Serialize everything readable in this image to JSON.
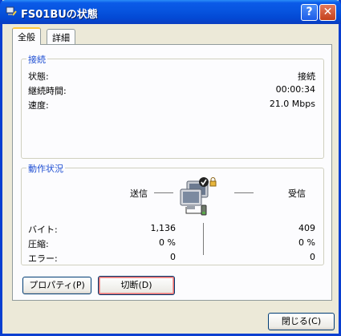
{
  "window": {
    "title": "FS01BUの状態",
    "help_glyph": "?",
    "close_glyph": "✕"
  },
  "tabs": [
    {
      "label": "全般",
      "active": true
    },
    {
      "label": "詳細",
      "active": false
    }
  ],
  "connection": {
    "legend": "接続",
    "rows": [
      {
        "label": "状態:",
        "value": "接続"
      },
      {
        "label": "継続時間:",
        "value": "00:00:34"
      },
      {
        "label": "速度:",
        "value": "21.0 Mbps"
      }
    ]
  },
  "activity": {
    "legend": "動作状況",
    "sent_label": "送信",
    "received_label": "受信",
    "rows": [
      {
        "label": "バイト:",
        "sent": "1,136",
        "received": "409"
      },
      {
        "label": "圧縮:",
        "sent": "0 %",
        "received": "0 %"
      },
      {
        "label": "エラー:",
        "sent": "0",
        "received": "0"
      }
    ],
    "icon": "network-computers-icon"
  },
  "buttons": {
    "properties": "プロパティ(P)",
    "disconnect": "切断(D)",
    "close": "閉じる(C)"
  },
  "colors": {
    "titlebar": "#0754df",
    "group_legend": "#1e4ed2",
    "focus_highlight": "#e36b6b"
  }
}
